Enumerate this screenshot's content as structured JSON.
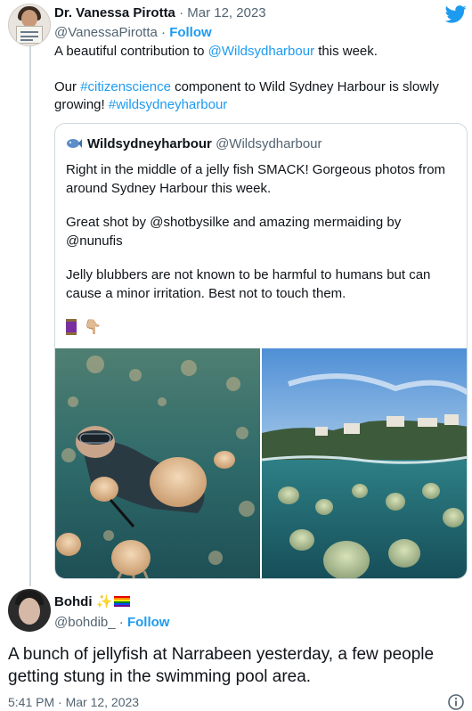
{
  "tweet1": {
    "name": "Dr. Vanessa Pirotta",
    "separator": "·",
    "date": "Mar 12, 2023",
    "handle": "@VanessaPirotta",
    "follow": "Follow",
    "line1_prefix": "A beautiful contribution to ",
    "line1_mention": "@Wildsydharbour",
    "line1_suffix": " this week.",
    "line2_prefix": "Our ",
    "line2_hashtag": "#citizenscience",
    "line2_suffix": " component to Wild Sydney Harbour is slowly",
    "line3_prefix": "growing! ",
    "line3_hashtag": "#wildsydneyharbour"
  },
  "quoted": {
    "name": "Wildsydneyharbour",
    "handle": "@Wildsydharbour",
    "p1_line1": "Right in the middle of a jelly fish SMACK! Gorgeous photos from",
    "p1_line2": "around Sydney Harbour this week.",
    "p2_line1": "Great shot by @shotbysilke and amazing mermaiding by",
    "p2_line2": "@nunufis",
    "p3_line1": "Jelly blubbers are not known to be harmful to humans but can",
    "p3_line2": "cause a minor irritation. Best not to touch them.",
    "hand_emoji": "👇🏼",
    "icon": "fish-icon"
  },
  "tweet2": {
    "name": "Bohdi",
    "sparkles": "✨",
    "flag": "rainbow-flag-icon",
    "handle": "@bohdib_",
    "separator": "·",
    "follow": "Follow",
    "text_line1": "A bunch of jellyfish at Narrabeen yesterday, a few people",
    "text_line2": "getting stung in the swimming pool area.",
    "time": "5:41 PM · Mar 12, 2023"
  },
  "colors": {
    "link": "#1d9bf0",
    "muted": "#536471",
    "text": "#0f1419",
    "border": "#cfd9de"
  }
}
